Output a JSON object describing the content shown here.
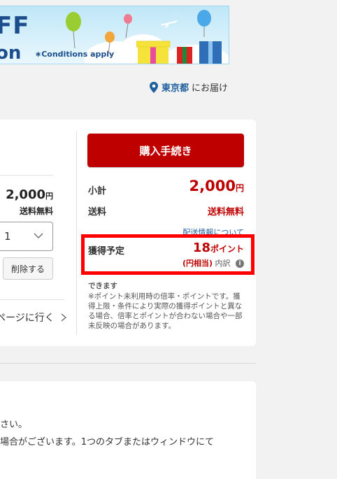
{
  "banner": {
    "headline": "FF",
    "coupon_text": "on",
    "conditions": "∗Conditions apply"
  },
  "delivery": {
    "prefecture": "東京都",
    "suffix": "にお届け"
  },
  "item": {
    "price": "2,000",
    "currency": "円",
    "shipping": "送料無料",
    "quantity": "1",
    "delete_label": "削除する",
    "link_text": "ページに行く"
  },
  "summary": {
    "checkout_label": "購入手続き",
    "subtotal_label": "小計",
    "subtotal_value": "2,000",
    "subtotal_currency": "円",
    "shipping_label": "送料",
    "shipping_value": "送料無料",
    "shipping_info_link": "配送情報について",
    "points_label": "獲得予定",
    "points_value": "18",
    "points_unit": "ポイント",
    "points_yen": "(円相当)",
    "points_breakdown": "内訳",
    "red_note": "できます",
    "note": "※ポイント未利用時の倍率・ポイントです。獲得上限・条件により実際の獲得ポイントと異なる場合、倍率とポイントが合わない場合や一部未反映の場合があります。"
  },
  "notice": {
    "line1": "さい。",
    "line2": "場合がございます。1つのタブまたはウィンドウにて"
  },
  "colors": {
    "brand_red": "#bf0000",
    "link_blue": "#1f5f9e",
    "highlight": "#ff0000"
  }
}
